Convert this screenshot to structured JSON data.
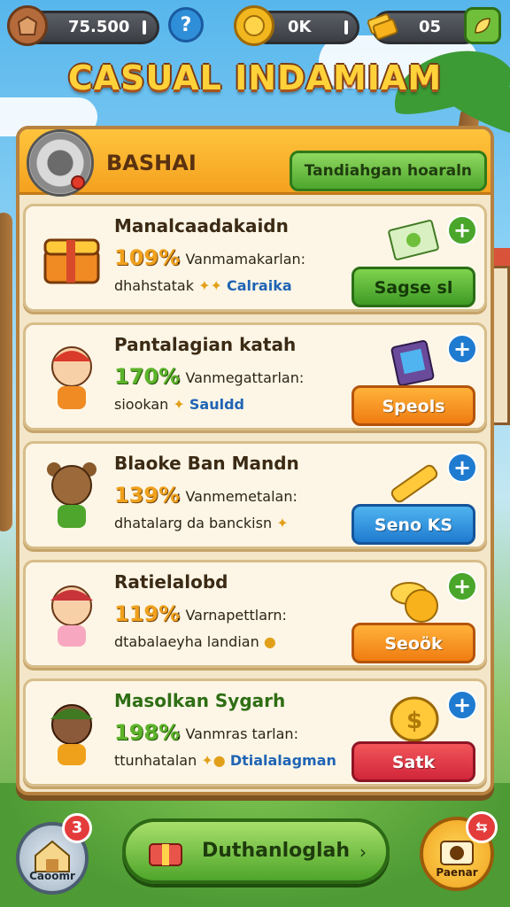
{
  "header": {
    "resource1": {
      "value": "75.500",
      "icon": "bag-icon"
    },
    "help_icon": "question-icon",
    "resource2": {
      "value": "0K",
      "icon": "coin-icon"
    },
    "resource3": {
      "value": "05",
      "icon": "gold-bar-icon"
    },
    "menu_icon": "leaf-icon"
  },
  "title": "CASUAL INDAMIAM",
  "panel": {
    "title": "BASHAI",
    "header_button": "Tandiahgan hoaraln",
    "cards": [
      {
        "name": "Manalcaadakaidn",
        "percent": "109%",
        "desc": ": Vanmamakarlan:",
        "line_text": "dhahstatak",
        "line_highlight": "Calraika",
        "action": "Sagse sl",
        "action_color": "#3f9a26",
        "plus_color": "#4aa62b",
        "item_icon": "money-bills-icon"
      },
      {
        "name": "Pantalagian katah",
        "percent": "170%",
        "desc": ": Vanmegattarlan:",
        "line_text": "siookan",
        "line_highlight": "Sauldd",
        "action": "Speols",
        "action_color": "#f07c12",
        "plus_color": "#1f7bd0",
        "item_icon": "book-icon"
      },
      {
        "name": "Blaoke Ban Mandn",
        "percent": "139%",
        "desc": ": Vanmemetalan:",
        "line_text": "dhatalarg da banckisn",
        "line_highlight": "",
        "action": "Seno KS",
        "action_color": "#1f7bd0",
        "plus_color": "#1f7bd0",
        "item_icon": "gold-ingot-icon"
      },
      {
        "name": "Ratielalobd",
        "percent": "119%",
        "desc": ": Varnapettlarn:",
        "line_text": "dtabalaeyha landian",
        "line_highlight": "",
        "action": "Seoök",
        "action_color": "#f07c12",
        "plus_color": "#4aa62b",
        "item_icon": "coin-stack-icon"
      },
      {
        "name": "Masolkan Sygarh",
        "percent": "198%",
        "desc": ": Vanmras tarlan:",
        "line_text": "ttunhatalan",
        "line_highlight": "Dtialalagman",
        "action": "Satk",
        "action_color": "#d1263a",
        "plus_color": "#1f7bd0",
        "item_icon": "gold-coin-icon"
      }
    ]
  },
  "bottom": {
    "left": {
      "label": "Caoomr",
      "badge": "3",
      "icon": "house-icon"
    },
    "main": {
      "label": "Duthanloglah",
      "icon": "gift-icon",
      "arrow": "›"
    },
    "right": {
      "label": "Paenar",
      "badge": "⇆",
      "icon": "camera-icon"
    }
  }
}
